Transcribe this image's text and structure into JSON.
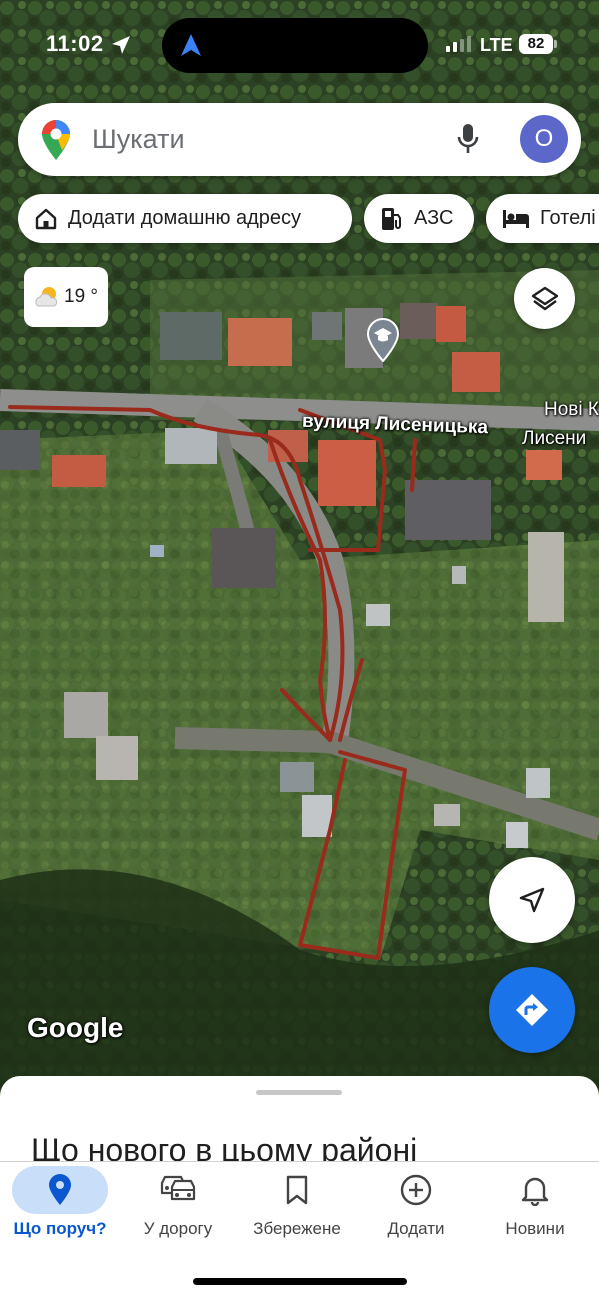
{
  "status_bar": {
    "time": "11:02",
    "network": "LTE",
    "battery": "82"
  },
  "search": {
    "placeholder": "Шукати",
    "avatar_letter": "О"
  },
  "chips": [
    {
      "label": "Додати домашню адресу",
      "icon": "home-icon"
    },
    {
      "label": "АЗС",
      "icon": "gas-station-icon"
    },
    {
      "label": "Готелі",
      "icon": "hotel-icon"
    }
  ],
  "weather": {
    "temperature": "19 °",
    "icon": "partly-cloudy-icon"
  },
  "map": {
    "street_label": "вулиця Лисеницька",
    "place_label_line1": "Нові К",
    "place_label_line2": "Лисени",
    "attribution": "Google",
    "colors": {
      "drawn_route": "#9a2a1c",
      "accent": "#1a73e8"
    }
  },
  "sheet": {
    "title": "Що нового в цьому районі"
  },
  "bottom_nav": [
    {
      "label": "Що поруч?",
      "icon": "location-pin-icon",
      "active": true
    },
    {
      "label": "У дорогу",
      "icon": "car-icon",
      "active": false
    },
    {
      "label": "Збережене",
      "icon": "bookmark-icon",
      "active": false
    },
    {
      "label": "Додати",
      "icon": "add-circle-icon",
      "active": false
    },
    {
      "label": "Новини",
      "icon": "bell-icon",
      "active": false
    }
  ]
}
